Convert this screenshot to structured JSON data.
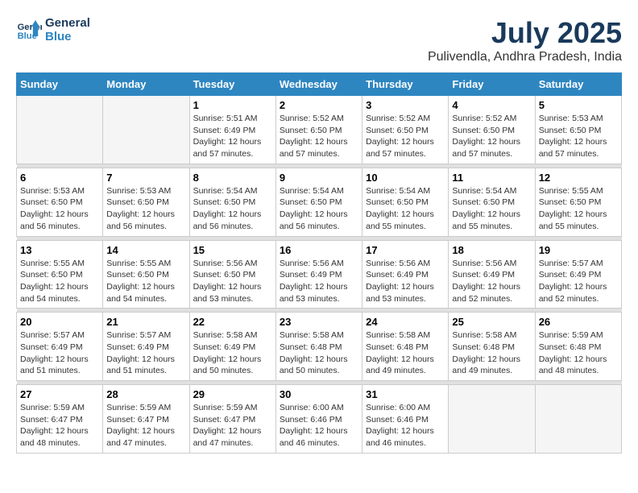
{
  "header": {
    "logo_line1": "General",
    "logo_line2": "Blue",
    "month_year": "July 2025",
    "location": "Pulivendla, Andhra Pradesh, India"
  },
  "days_of_week": [
    "Sunday",
    "Monday",
    "Tuesday",
    "Wednesday",
    "Thursday",
    "Friday",
    "Saturday"
  ],
  "weeks": [
    [
      {
        "day": "",
        "info": ""
      },
      {
        "day": "",
        "info": ""
      },
      {
        "day": "1",
        "sunrise": "5:51 AM",
        "sunset": "6:49 PM",
        "daylight": "12 hours and 57 minutes."
      },
      {
        "day": "2",
        "sunrise": "5:52 AM",
        "sunset": "6:50 PM",
        "daylight": "12 hours and 57 minutes."
      },
      {
        "day": "3",
        "sunrise": "5:52 AM",
        "sunset": "6:50 PM",
        "daylight": "12 hours and 57 minutes."
      },
      {
        "day": "4",
        "sunrise": "5:52 AM",
        "sunset": "6:50 PM",
        "daylight": "12 hours and 57 minutes."
      },
      {
        "day": "5",
        "sunrise": "5:53 AM",
        "sunset": "6:50 PM",
        "daylight": "12 hours and 57 minutes."
      }
    ],
    [
      {
        "day": "6",
        "sunrise": "5:53 AM",
        "sunset": "6:50 PM",
        "daylight": "12 hours and 56 minutes."
      },
      {
        "day": "7",
        "sunrise": "5:53 AM",
        "sunset": "6:50 PM",
        "daylight": "12 hours and 56 minutes."
      },
      {
        "day": "8",
        "sunrise": "5:54 AM",
        "sunset": "6:50 PM",
        "daylight": "12 hours and 56 minutes."
      },
      {
        "day": "9",
        "sunrise": "5:54 AM",
        "sunset": "6:50 PM",
        "daylight": "12 hours and 56 minutes."
      },
      {
        "day": "10",
        "sunrise": "5:54 AM",
        "sunset": "6:50 PM",
        "daylight": "12 hours and 55 minutes."
      },
      {
        "day": "11",
        "sunrise": "5:54 AM",
        "sunset": "6:50 PM",
        "daylight": "12 hours and 55 minutes."
      },
      {
        "day": "12",
        "sunrise": "5:55 AM",
        "sunset": "6:50 PM",
        "daylight": "12 hours and 55 minutes."
      }
    ],
    [
      {
        "day": "13",
        "sunrise": "5:55 AM",
        "sunset": "6:50 PM",
        "daylight": "12 hours and 54 minutes."
      },
      {
        "day": "14",
        "sunrise": "5:55 AM",
        "sunset": "6:50 PM",
        "daylight": "12 hours and 54 minutes."
      },
      {
        "day": "15",
        "sunrise": "5:56 AM",
        "sunset": "6:50 PM",
        "daylight": "12 hours and 53 minutes."
      },
      {
        "day": "16",
        "sunrise": "5:56 AM",
        "sunset": "6:49 PM",
        "daylight": "12 hours and 53 minutes."
      },
      {
        "day": "17",
        "sunrise": "5:56 AM",
        "sunset": "6:49 PM",
        "daylight": "12 hours and 53 minutes."
      },
      {
        "day": "18",
        "sunrise": "5:56 AM",
        "sunset": "6:49 PM",
        "daylight": "12 hours and 52 minutes."
      },
      {
        "day": "19",
        "sunrise": "5:57 AM",
        "sunset": "6:49 PM",
        "daylight": "12 hours and 52 minutes."
      }
    ],
    [
      {
        "day": "20",
        "sunrise": "5:57 AM",
        "sunset": "6:49 PM",
        "daylight": "12 hours and 51 minutes."
      },
      {
        "day": "21",
        "sunrise": "5:57 AM",
        "sunset": "6:49 PM",
        "daylight": "12 hours and 51 minutes."
      },
      {
        "day": "22",
        "sunrise": "5:58 AM",
        "sunset": "6:49 PM",
        "daylight": "12 hours and 50 minutes."
      },
      {
        "day": "23",
        "sunrise": "5:58 AM",
        "sunset": "6:48 PM",
        "daylight": "12 hours and 50 minutes."
      },
      {
        "day": "24",
        "sunrise": "5:58 AM",
        "sunset": "6:48 PM",
        "daylight": "12 hours and 49 minutes."
      },
      {
        "day": "25",
        "sunrise": "5:58 AM",
        "sunset": "6:48 PM",
        "daylight": "12 hours and 49 minutes."
      },
      {
        "day": "26",
        "sunrise": "5:59 AM",
        "sunset": "6:48 PM",
        "daylight": "12 hours and 48 minutes."
      }
    ],
    [
      {
        "day": "27",
        "sunrise": "5:59 AM",
        "sunset": "6:47 PM",
        "daylight": "12 hours and 48 minutes."
      },
      {
        "day": "28",
        "sunrise": "5:59 AM",
        "sunset": "6:47 PM",
        "daylight": "12 hours and 47 minutes."
      },
      {
        "day": "29",
        "sunrise": "5:59 AM",
        "sunset": "6:47 PM",
        "daylight": "12 hours and 47 minutes."
      },
      {
        "day": "30",
        "sunrise": "6:00 AM",
        "sunset": "6:46 PM",
        "daylight": "12 hours and 46 minutes."
      },
      {
        "day": "31",
        "sunrise": "6:00 AM",
        "sunset": "6:46 PM",
        "daylight": "12 hours and 46 minutes."
      },
      {
        "day": "",
        "info": ""
      },
      {
        "day": "",
        "info": ""
      }
    ]
  ],
  "labels": {
    "sunrise_prefix": "Sunrise: ",
    "sunset_prefix": "Sunset: ",
    "daylight_prefix": "Daylight: "
  }
}
